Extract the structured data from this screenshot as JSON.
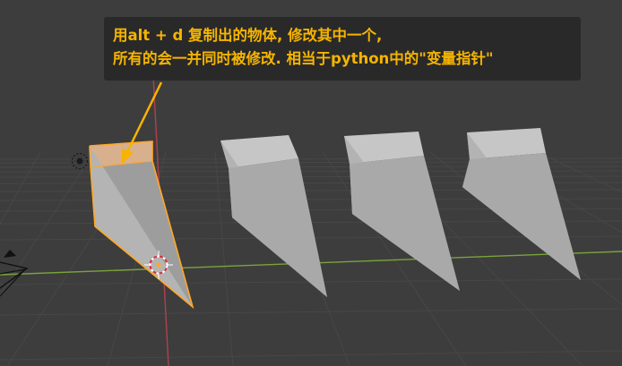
{
  "annotation": {
    "line1": "用alt + d 复制出的物体, 修改其中一个,",
    "line2": "所有的会一并同时被修改. 相当于python中的\"变量指针\"",
    "text_color": "#f5b400"
  },
  "colors": {
    "background": "#3d3d3d",
    "selection_outline": "#ffa726",
    "x_axis": "#7aa33c",
    "y_axis": "#b0414d"
  }
}
